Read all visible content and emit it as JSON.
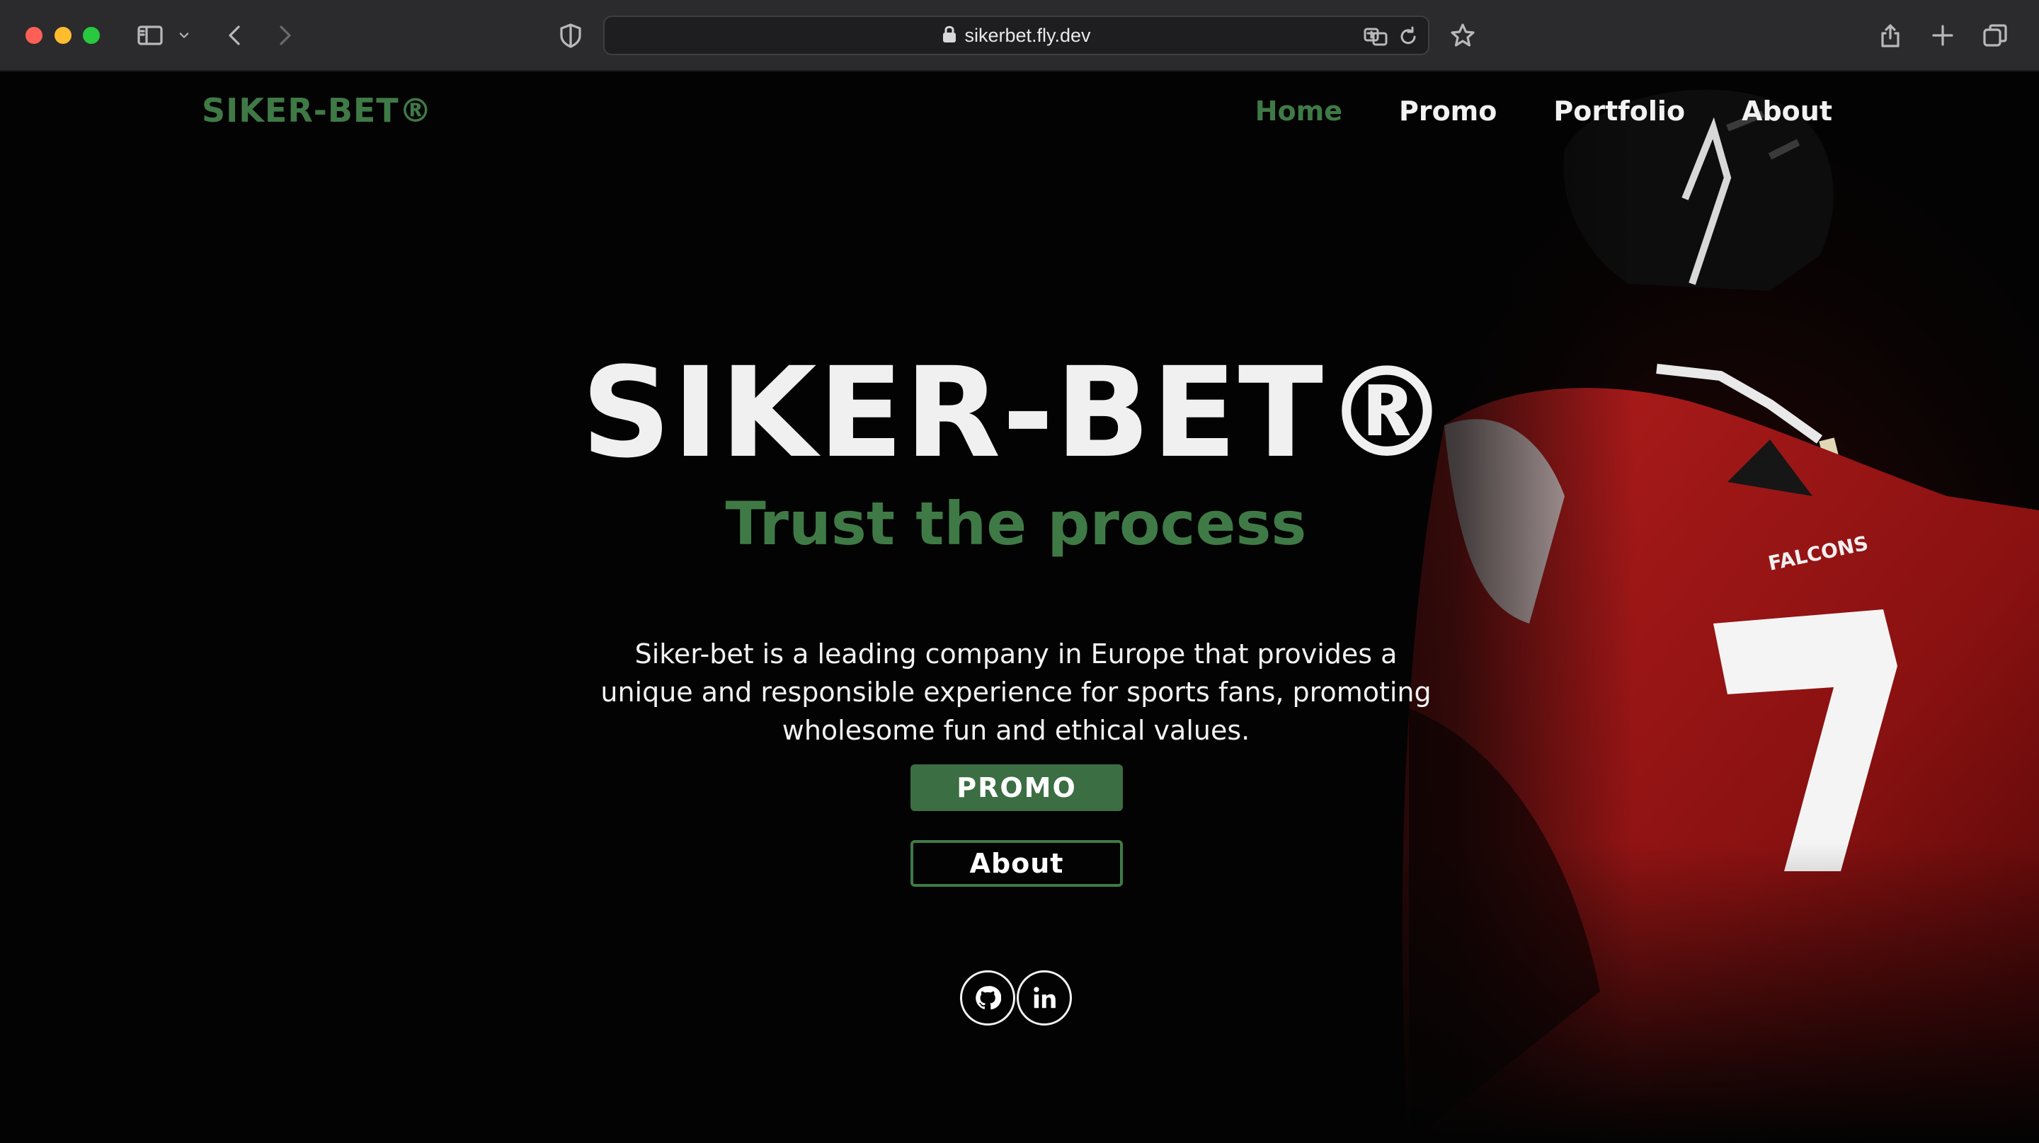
{
  "browser": {
    "url": "sikerbet.fly.dev",
    "icons": [
      "sidebar-icon",
      "chevron-down-icon",
      "back-icon",
      "forward-icon",
      "shield-icon",
      "lock-icon",
      "translate-icon",
      "reload-icon",
      "bookmark-star-icon",
      "share-icon",
      "new-tab-icon",
      "tabs-overview-icon"
    ]
  },
  "nav": {
    "logo": "SIKER-BET®",
    "links": [
      {
        "label": "Home",
        "active": true
      },
      {
        "label": "Promo",
        "active": false
      },
      {
        "label": "Portfolio",
        "active": false
      },
      {
        "label": "About",
        "active": false
      }
    ]
  },
  "hero": {
    "title": "SIKER-BET®",
    "subtitle": "Trust the process",
    "description": "Siker-bet is a leading company in Europe that provides a unique and responsible experience for sports fans, promoting wholesome fun and ethical values.",
    "primary_button": "PROMO",
    "secondary_button": "About",
    "social": [
      "github-icon",
      "linkedin-icon"
    ]
  },
  "colors": {
    "accent_green": "#3f7a46",
    "background": "#030303",
    "chrome": "#2b2b2d",
    "jersey_red": "#8e1414"
  }
}
